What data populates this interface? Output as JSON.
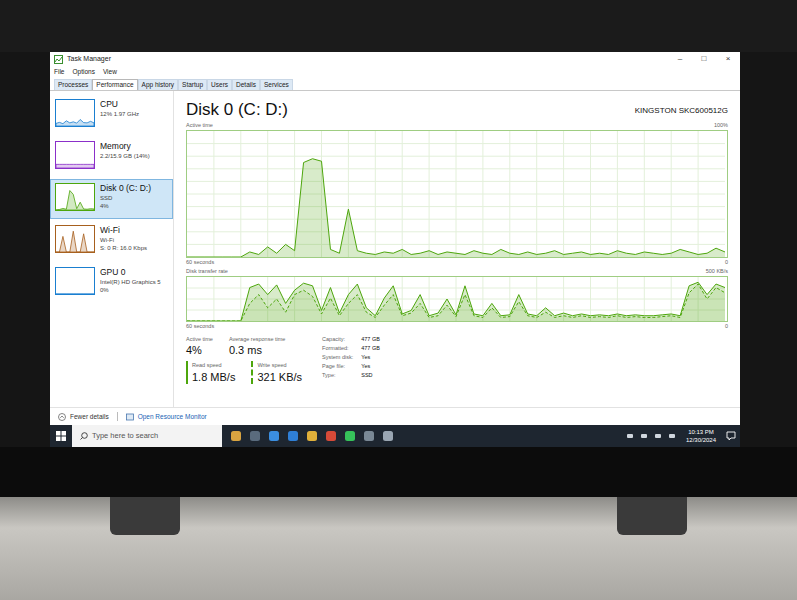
{
  "window": {
    "title": "Task Manager",
    "controls": [
      "–",
      "□",
      "×"
    ]
  },
  "menu": [
    "File",
    "Options",
    "View"
  ],
  "tabs": [
    {
      "label": "Processes",
      "selected": false
    },
    {
      "label": "Performance",
      "selected": true
    },
    {
      "label": "App history",
      "selected": false
    },
    {
      "label": "Startup",
      "selected": false
    },
    {
      "label": "Users",
      "selected": false
    },
    {
      "label": "Details",
      "selected": false
    },
    {
      "label": "Services",
      "selected": false
    }
  ],
  "sidebar": {
    "items": [
      {
        "name": "CPU",
        "lines": [
          "12% 1.97 GHz"
        ],
        "selected": false,
        "color": "#1a7fd0",
        "spark": [
          10,
          14,
          9,
          20,
          12,
          16,
          11,
          25,
          13,
          12,
          18,
          12
        ]
      },
      {
        "name": "Memory",
        "lines": [
          "2.2/15.9 GB (14%)"
        ],
        "selected": false,
        "color": "#8b2fc9",
        "spark": [
          14,
          14,
          14,
          14,
          14,
          14,
          14,
          14,
          14,
          14,
          14,
          14
        ]
      },
      {
        "name": "Disk 0 (C: D:)",
        "lines": [
          "SSD",
          "4%"
        ],
        "selected": true,
        "color": "#4da60c",
        "spark": [
          0,
          2,
          6,
          3,
          75,
          60,
          5,
          30,
          4,
          3,
          5,
          4
        ]
      },
      {
        "name": "Wi-Fi",
        "lines": [
          "Wi-Fi",
          "S: 0 R: 16.0 Kbps"
        ],
        "selected": false,
        "color": "#a7601e",
        "spark": [
          0,
          0,
          60,
          0,
          0,
          80,
          0,
          0,
          70,
          0,
          0,
          0
        ]
      },
      {
        "name": "GPU 0",
        "lines": [
          "Intel(R) HD Graphics 5",
          "0%"
        ],
        "selected": false,
        "color": "#1a7fd0",
        "spark": [
          0,
          0,
          0,
          0,
          0,
          0,
          0,
          0,
          0,
          0,
          0,
          0
        ]
      }
    ]
  },
  "panel": {
    "title": "Disk 0 (C: D:)",
    "model": "KINGSTON SKC600512G",
    "active_chart": {
      "label": "Active time",
      "max_label": "100%",
      "span": "60 seconds",
      "min_label": "0",
      "max": 100,
      "series": [
        {
          "name": "Active time",
          "values": [
            0,
            0,
            0,
            0,
            0,
            0,
            0,
            4,
            2,
            8,
            3,
            10,
            5,
            75,
            78,
            76,
            6,
            3,
            38,
            5,
            3,
            2,
            4,
            3,
            6,
            2,
            3,
            5,
            2,
            4,
            3,
            2,
            5,
            3,
            2,
            6,
            3,
            2,
            4,
            2,
            3,
            5,
            2,
            3,
            4,
            2,
            3,
            2,
            5,
            3,
            2,
            4,
            3,
            2,
            3,
            6,
            4,
            2,
            3,
            7,
            4
          ]
        }
      ]
    },
    "transfer_chart": {
      "label": "Disk transfer rate",
      "max_label": "500 KB/s",
      "span": "60 seconds",
      "min_label": "0",
      "max": 500,
      "series": [
        {
          "name": "Read speed",
          "dashed": false,
          "values": [
            0,
            0,
            0,
            0,
            0,
            0,
            0,
            380,
            420,
            300,
            410,
            200,
            350,
            430,
            400,
            120,
            380,
            90,
            300,
            420,
            150,
            60,
            260,
            400,
            80,
            120,
            300,
            60,
            90,
            250,
            70,
            400,
            80,
            60,
            200,
            60,
            70,
            300,
            80,
            60,
            150,
            60,
            90,
            60,
            80,
            60,
            70,
            60,
            80,
            60,
            70,
            60,
            60,
            70,
            80,
            60,
            400,
            440,
            300,
            420,
            380
          ]
        },
        {
          "name": "Write speed",
          "dashed": true,
          "values": [
            0,
            0,
            0,
            0,
            0,
            0,
            0,
            200,
            300,
            150,
            250,
            100,
            300,
            350,
            280,
            80,
            260,
            60,
            200,
            300,
            100,
            40,
            180,
            300,
            60,
            90,
            200,
            40,
            60,
            180,
            50,
            300,
            60,
            40,
            150,
            40,
            50,
            220,
            60,
            40,
            100,
            40,
            60,
            40,
            60,
            40,
            50,
            40,
            60,
            40,
            50,
            40,
            40,
            50,
            60,
            40,
            320,
            420,
            250,
            380,
            321
          ]
        }
      ]
    },
    "stats": [
      {
        "label": "Active time",
        "value": "4%"
      },
      {
        "label": "Average response time",
        "value": "0.3 ms"
      }
    ],
    "speeds": [
      {
        "label": "Read speed",
        "value": "1.8 MB/s",
        "dashed": false
      },
      {
        "label": "Write speed",
        "value": "321 KB/s",
        "dashed": true
      }
    ],
    "properties": [
      {
        "label": "Capacity:",
        "value": "477 GB"
      },
      {
        "label": "Formatted:",
        "value": "477 GB"
      },
      {
        "label": "System disk:",
        "value": "Yes"
      },
      {
        "label": "Page file:",
        "value": "Yes"
      },
      {
        "label": "Type:",
        "value": "SSD"
      }
    ]
  },
  "footer": {
    "fewer": "Fewer details",
    "monitor": "Open Resource Monitor"
  },
  "taskbar": {
    "search": "Type here to search",
    "time": "10:13 PM",
    "date": "12/30/2024"
  }
}
